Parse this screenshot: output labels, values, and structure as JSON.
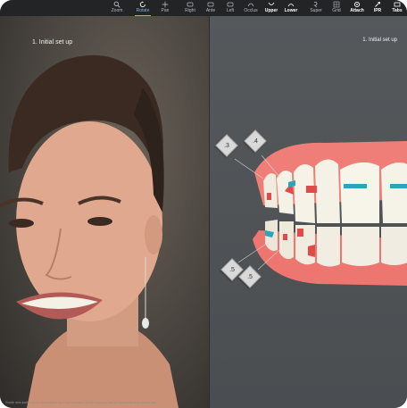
{
  "toolbar": {
    "tools": [
      {
        "label": "Zoom",
        "icon": "zoom-icon"
      },
      {
        "label": "Rotate",
        "icon": "rotate-icon",
        "active": true
      },
      {
        "label": "Pan",
        "icon": "pan-icon"
      },
      {
        "label": "Right",
        "icon": "right-view-icon"
      },
      {
        "label": "Ante",
        "icon": "anterior-view-icon"
      },
      {
        "label": "Left",
        "icon": "left-view-icon"
      },
      {
        "label": "Occlus",
        "icon": "occlusal-view-icon"
      },
      {
        "label": "Upper",
        "icon": "upper-jaw-icon",
        "bold": true
      },
      {
        "label": "Lower",
        "icon": "lower-jaw-icon",
        "bold": true
      },
      {
        "label": "Super",
        "icon": "superimpose-icon"
      },
      {
        "label": "Grid",
        "icon": "grid-icon"
      },
      {
        "label": "Attach",
        "icon": "attachment-icon",
        "bold": true
      },
      {
        "label": "IPR",
        "icon": "ipr-icon",
        "bold": true
      },
      {
        "label": "Tabs",
        "icon": "tabs-icon",
        "bold": true
      }
    ]
  },
  "left_panel": {
    "step_title": "1. Initial set up"
  },
  "right_panel": {
    "step_title": "1. Initial set up",
    "ipr_markers": [
      {
        "value": ".3"
      },
      {
        "value": ".4"
      },
      {
        "value": ".5"
      },
      {
        "value": ".5"
      }
    ]
  },
  "footer": {
    "note": "Smile simulation is an illustration and not intended to be a guarantee of actual clinical outcomes"
  },
  "colors": {
    "toolbar_bg": "#222426",
    "active_tool": "#7fb4e8",
    "viewport_bg": "#4f5356",
    "gum": "#f07e78",
    "tooth": "#f4f1e6",
    "attachment_red": "#e24a4a",
    "attachment_teal": "#2aa6b8"
  }
}
